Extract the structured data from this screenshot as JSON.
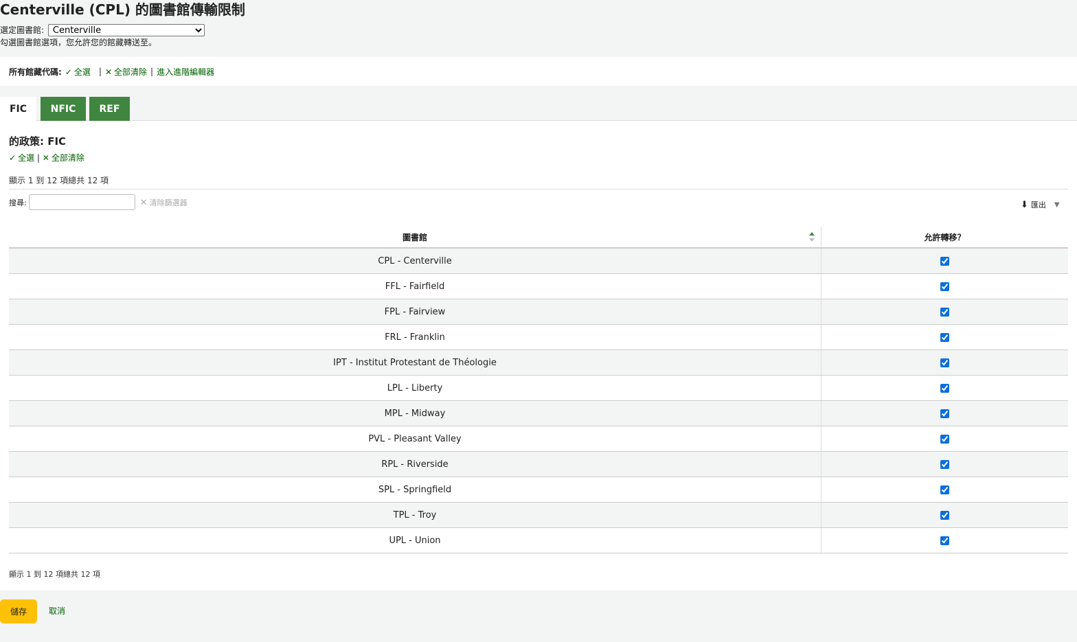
{
  "page": {
    "title": "Centerville (CPL) 的圖書館傳輸限制"
  },
  "branch_select": {
    "label": "選定圖書館:",
    "value": "Centerville"
  },
  "instructions": "勾選圖書館選項，您允許您的館藏轉送至。",
  "all_codes": {
    "label": "所有館藏代碼:",
    "select_all": "全選",
    "clear_all": "全部清除",
    "sep": "|",
    "advanced_editor": "進入進階編輯器"
  },
  "tabs": [
    {
      "label": "FIC",
      "active": true
    },
    {
      "label": "NFIC",
      "active": false
    },
    {
      "label": "REF",
      "active": false
    }
  ],
  "policy": {
    "heading": "的政策: FIC",
    "select_all": "全選",
    "clear_all": "全部清除",
    "sep": "|"
  },
  "table_info": {
    "top": "顯示 1 到 12 項總共 12 項",
    "bottom": "顯示 1 到 12 項總共 12 項"
  },
  "search": {
    "label": "搜尋:",
    "value": "",
    "clear_filter": "清除篩選器"
  },
  "export": {
    "label": "匯出",
    "caret": "▼"
  },
  "table": {
    "headers": {
      "library": "圖書館",
      "allow": "允許轉移？"
    },
    "rows": [
      {
        "library": "CPL - Centerville",
        "checked": true
      },
      {
        "library": "FFL - Fairfield",
        "checked": true
      },
      {
        "library": "FPL - Fairview",
        "checked": true
      },
      {
        "library": "FRL - Franklin",
        "checked": true
      },
      {
        "library": "IPT - Institut Protestant de Théologie",
        "checked": true
      },
      {
        "library": "LPL - Liberty",
        "checked": true
      },
      {
        "library": "MPL - Midway",
        "checked": true
      },
      {
        "library": "PVL - Pleasant Valley",
        "checked": true
      },
      {
        "library": "RPL - Riverside",
        "checked": true
      },
      {
        "library": "SPL - Springfield",
        "checked": true
      },
      {
        "library": "TPL - Troy",
        "checked": true
      },
      {
        "library": "UPL - Union",
        "checked": true
      }
    ]
  },
  "actions": {
    "save": "儲存",
    "cancel": "取消"
  },
  "colors": {
    "accent_green": "#408540",
    "link_green": "#006100",
    "save_yellow": "#ffc107"
  },
  "icons": {
    "check": "check-icon",
    "clear": "x-icon",
    "export": "download-icon"
  }
}
